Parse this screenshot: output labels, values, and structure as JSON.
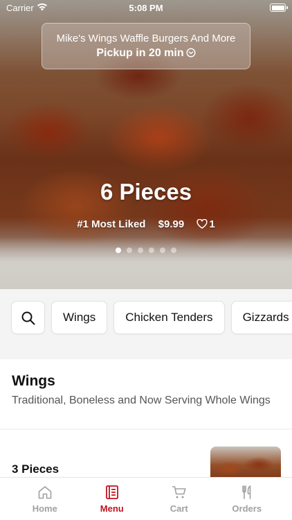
{
  "status_bar": {
    "carrier": "Carrier",
    "time": "5:08 PM"
  },
  "store": {
    "name": "Mike's Wings Waffle Burgers And More",
    "pickup": "Pickup in 20 min"
  },
  "featured": {
    "title": "6 Pieces",
    "rank": "#1 Most Liked",
    "price": "$9.99",
    "likes": "1",
    "slide_count": 6,
    "active_slide": 1
  },
  "categories": [
    "Wings",
    "Chicken Tenders",
    "Gizzards"
  ],
  "section": {
    "title": "Wings",
    "description": "Traditional, Boneless and Now Serving Whole Wings"
  },
  "items": [
    {
      "name": "3 Pieces"
    }
  ],
  "tabs": [
    {
      "label": "Home",
      "icon": "home-icon"
    },
    {
      "label": "Menu",
      "icon": "menu-book-icon"
    },
    {
      "label": "Cart",
      "icon": "cart-icon"
    },
    {
      "label": "Orders",
      "icon": "utensils-icon"
    }
  ],
  "active_tab": "Menu",
  "colors": {
    "accent": "#c1121f",
    "inactive": "#a0a0a0",
    "background": "#f4f4f4"
  }
}
